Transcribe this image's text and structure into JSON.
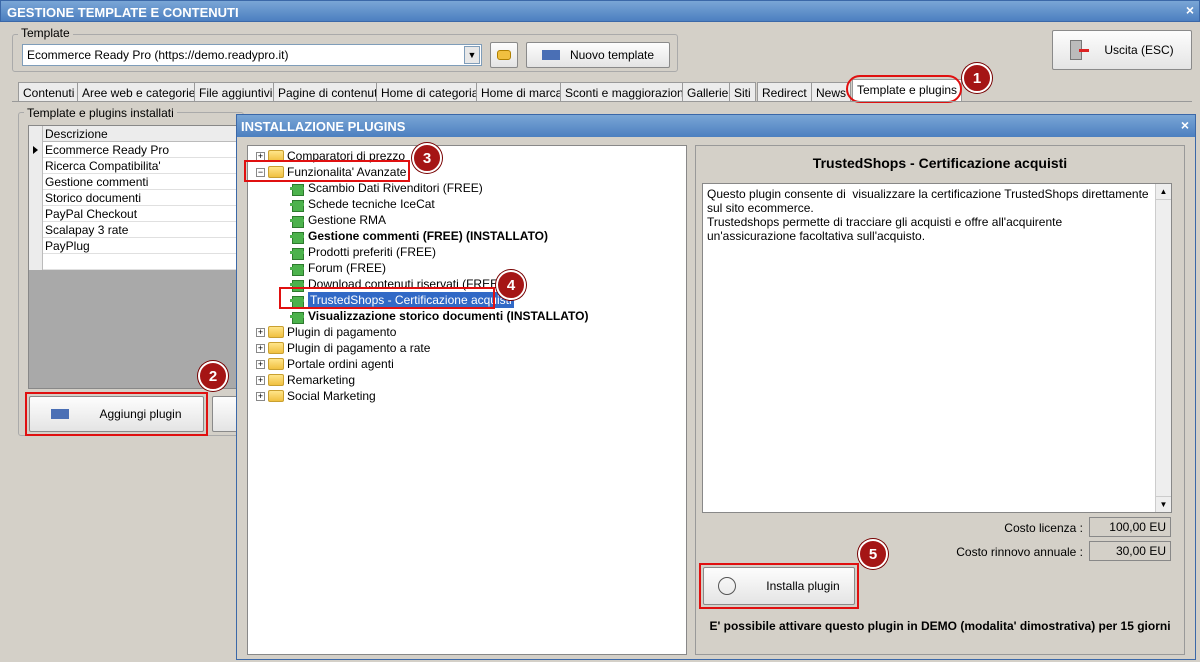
{
  "window": {
    "title": "GESTIONE TEMPLATE E CONTENUTI",
    "close": "×"
  },
  "template": {
    "legend": "Template",
    "selected": "Ecommerce Ready Pro (https://demo.readypro.it)",
    "new_button": "Nuovo template"
  },
  "exit_button": "Uscita (ESC)",
  "tabs": [
    "Contenuti",
    "Aree web e categorie",
    "File aggiuntivi",
    "Pagine di contenuti",
    "Home di categoria",
    "Home di marca",
    "Sconti e maggiorazioni",
    "Gallerie",
    "Siti",
    "Redirect",
    "News",
    "Template e plugins"
  ],
  "installed": {
    "legend": "Template e plugins installati",
    "header": "Descrizione",
    "rows": [
      "Ecommerce Ready Pro",
      "Ricerca Compatibilita'",
      "Gestione commenti",
      "Storico documenti",
      "PayPal Checkout",
      "Scalapay 3 rate",
      "PayPlug"
    ],
    "add_button": "Aggiungi plugin"
  },
  "dialog": {
    "title": "INSTALLAZIONE PLUGINS",
    "close": "×",
    "tree": {
      "cat_comparatori": "Comparatori di prezzo",
      "cat_funzionalita": "Funzionalita' Avanzate",
      "items": [
        {
          "label": "Scambio Dati Rivenditori (FREE)",
          "bold": false
        },
        {
          "label": "Schede tecniche IceCat",
          "bold": false
        },
        {
          "label": "Gestione RMA",
          "bold": false
        },
        {
          "label": "Gestione commenti (FREE) (INSTALLATO)",
          "bold": true
        },
        {
          "label": "Prodotti preferiti (FREE)",
          "bold": false
        },
        {
          "label": "Forum (FREE)",
          "bold": false
        },
        {
          "label": "Download contenuti riservati (FREE)",
          "bold": false
        },
        {
          "label": "TrustedShops - Certificazione acquisti",
          "bold": false,
          "selected": true
        },
        {
          "label": "Visualizzazione storico documenti (INSTALLATO)",
          "bold": true
        }
      ],
      "other_cats": [
        "Plugin di pagamento",
        "Plugin di pagamento a rate",
        "Portale ordini agenti",
        "Remarketing",
        "Social Marketing"
      ]
    },
    "detail": {
      "title": "TrustedShops - Certificazione acquisti",
      "description": "Questo plugin consente di  visualizzare la certificazione TrustedShops direttamente sul sito ecommerce.\nTrustedshops permette di tracciare gli acquisti e offre all'acquirente un'assicurazione facoltativa sull'acquisto.",
      "cost_license_label": "Costo licenza :",
      "cost_license_value": "100,00 EU",
      "cost_renewal_label": "Costo rinnovo annuale :",
      "cost_renewal_value": "30,00 EU",
      "install_button": "Installa plugin",
      "demo_note": "E' possibile attivare questo plugin in DEMO (modalita' dimostrativa) per 15 giorni"
    }
  },
  "badges": [
    "1",
    "2",
    "3",
    "4",
    "5"
  ]
}
